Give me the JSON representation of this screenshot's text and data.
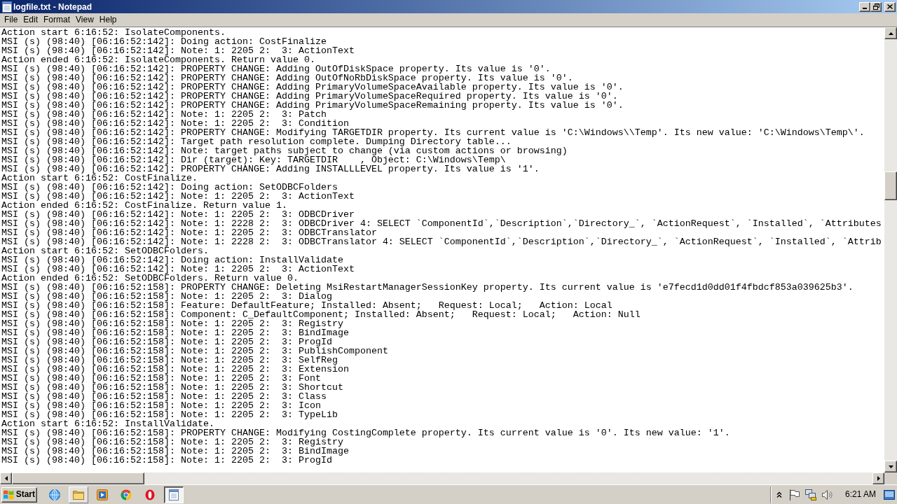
{
  "window": {
    "title": "logfile.txt - Notepad"
  },
  "menu": [
    "File",
    "Edit",
    "Format",
    "View",
    "Help"
  ],
  "document": {
    "lines": [
      "Action start 6:16:52: IsolateComponents.",
      "MSI (s) (98:40) [06:16:52:142]: Doing action: CostFinalize",
      "MSI (s) (98:40) [06:16:52:142]: Note: 1: 2205 2:  3: ActionText",
      "Action ended 6:16:52: IsolateComponents. Return value 0.",
      "MSI (s) (98:40) [06:16:52:142]: PROPERTY CHANGE: Adding OutOfDiskSpace property. Its value is '0'.",
      "MSI (s) (98:40) [06:16:52:142]: PROPERTY CHANGE: Adding OutOfNoRbDiskSpace property. Its value is '0'.",
      "MSI (s) (98:40) [06:16:52:142]: PROPERTY CHANGE: Adding PrimaryVolumeSpaceAvailable property. Its value is '0'.",
      "MSI (s) (98:40) [06:16:52:142]: PROPERTY CHANGE: Adding PrimaryVolumeSpaceRequired property. Its value is '0'.",
      "MSI (s) (98:40) [06:16:52:142]: PROPERTY CHANGE: Adding PrimaryVolumeSpaceRemaining property. Its value is '0'.",
      "MSI (s) (98:40) [06:16:52:142]: Note: 1: 2205 2:  3: Patch",
      "MSI (s) (98:40) [06:16:52:142]: Note: 1: 2205 2:  3: Condition",
      "MSI (s) (98:40) [06:16:52:142]: PROPERTY CHANGE: Modifying TARGETDIR property. Its current value is 'C:\\Windows\\\\Temp'. Its new value: 'C:\\Windows\\Temp\\'.",
      "MSI (s) (98:40) [06:16:52:142]: Target path resolution complete. Dumping Directory table...",
      "MSI (s) (98:40) [06:16:52:142]: Note: target paths subject to change (via custom actions or browsing)",
      "MSI (s) (98:40) [06:16:52:142]: Dir (target): Key: TARGETDIR    , Object: C:\\Windows\\Temp\\",
      "MSI (s) (98:40) [06:16:52:142]: PROPERTY CHANGE: Adding INSTALLLEVEL property. Its value is '1'.",
      "Action start 6:16:52: CostFinalize.",
      "MSI (s) (98:40) [06:16:52:142]: Doing action: SetODBCFolders",
      "MSI (s) (98:40) [06:16:52:142]: Note: 1: 2205 2:  3: ActionText",
      "Action ended 6:16:52: CostFinalize. Return value 1.",
      "MSI (s) (98:40) [06:16:52:142]: Note: 1: 2205 2:  3: ODBCDriver",
      "MSI (s) (98:40) [06:16:52:142]: Note: 1: 2228 2:  3: ODBCDriver 4: SELECT `ComponentId`,`Description`,`Directory_`, `ActionRequest`, `Installed`, `Attributes",
      "MSI (s) (98:40) [06:16:52:142]: Note: 1: 2205 2:  3: ODBCTranslator",
      "MSI (s) (98:40) [06:16:52:142]: Note: 1: 2228 2:  3: ODBCTranslator 4: SELECT `ComponentId`,`Description`,`Directory_`, `ActionRequest`, `Installed`, `Attrib",
      "Action start 6:16:52: SetODBCFolders.",
      "MSI (s) (98:40) [06:16:52:142]: Doing action: InstallValidate",
      "MSI (s) (98:40) [06:16:52:142]: Note: 1: 2205 2:  3: ActionText",
      "Action ended 6:16:52: SetODBCFolders. Return value 0.",
      "MSI (s) (98:40) [06:16:52:158]: PROPERTY CHANGE: Deleting MsiRestartManagerSessionKey property. Its current value is 'e7fecd1d0dd01f4fbdcf853a039625b3'.",
      "MSI (s) (98:40) [06:16:52:158]: Note: 1: 2205 2:  3: Dialog",
      "MSI (s) (98:40) [06:16:52:158]: Feature: DefaultFeature; Installed: Absent;   Request: Local;   Action: Local",
      "MSI (s) (98:40) [06:16:52:158]: Component: C_DefaultComponent; Installed: Absent;   Request: Local;   Action: Null",
      "MSI (s) (98:40) [06:16:52:158]: Note: 1: 2205 2:  3: Registry",
      "MSI (s) (98:40) [06:16:52:158]: Note: 1: 2205 2:  3: BindImage",
      "MSI (s) (98:40) [06:16:52:158]: Note: 1: 2205 2:  3: ProgId",
      "MSI (s) (98:40) [06:16:52:158]: Note: 1: 2205 2:  3: PublishComponent",
      "MSI (s) (98:40) [06:16:52:158]: Note: 1: 2205 2:  3: SelfReg",
      "MSI (s) (98:40) [06:16:52:158]: Note: 1: 2205 2:  3: Extension",
      "MSI (s) (98:40) [06:16:52:158]: Note: 1: 2205 2:  3: Font",
      "MSI (s) (98:40) [06:16:52:158]: Note: 1: 2205 2:  3: Shortcut",
      "MSI (s) (98:40) [06:16:52:158]: Note: 1: 2205 2:  3: Class",
      "MSI (s) (98:40) [06:16:52:158]: Note: 1: 2205 2:  3: Icon",
      "MSI (s) (98:40) [06:16:52:158]: Note: 1: 2205 2:  3: TypeLib",
      "Action start 6:16:52: InstallValidate.",
      "MSI (s) (98:40) [06:16:52:158]: PROPERTY CHANGE: Modifying CostingComplete property. Its current value is '0'. Its new value: '1'.",
      "MSI (s) (98:40) [06:16:52:158]: Note: 1: 2205 2:  3: Registry",
      "MSI (s) (98:40) [06:16:52:158]: Note: 1: 2205 2:  3: BindImage",
      "MSI (s) (98:40) [06:16:52:158]: Note: 1: 2205 2:  3: ProgId"
    ]
  },
  "taskbar": {
    "start": "Start",
    "apps": [
      {
        "kind": "globe",
        "open": false,
        "selected": false
      },
      {
        "kind": "folder",
        "open": true,
        "selected": false
      },
      {
        "kind": "player",
        "open": false,
        "selected": false
      },
      {
        "kind": "ball",
        "open": false,
        "selected": false
      },
      {
        "kind": "oval",
        "open": false,
        "selected": false
      },
      {
        "kind": "notepad",
        "open": true,
        "selected": true
      }
    ],
    "clock": "6:21 AM"
  }
}
